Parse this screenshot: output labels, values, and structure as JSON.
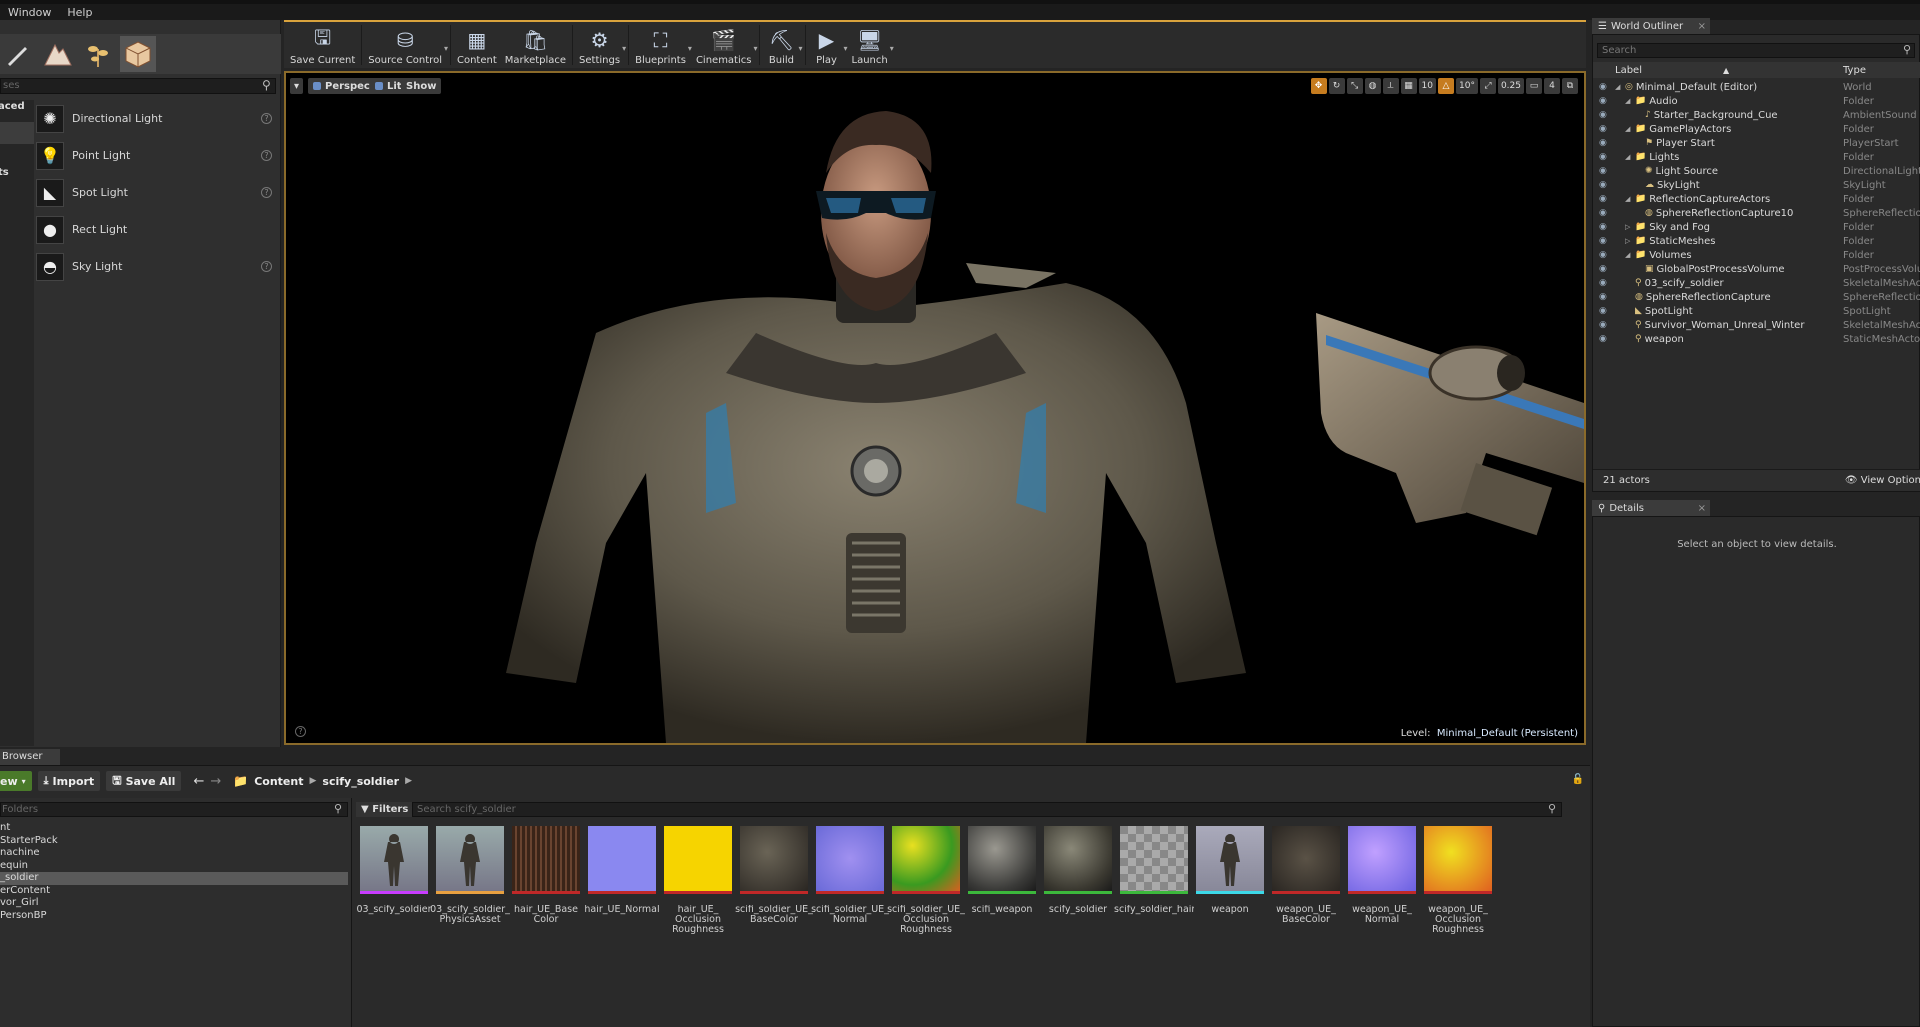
{
  "menu": {
    "items": [
      "Window",
      "Help"
    ],
    "close_glyph": "×"
  },
  "modes": {
    "icons": [
      "pencil-icon",
      "landscape-icon",
      "foliage-icon",
      "geometry-icon"
    ],
    "search_placeholder": "ses",
    "categories": [
      {
        "label": "aced",
        "selected": false
      },
      {
        "label": "",
        "selected": true
      },
      {
        "label": "",
        "selected": false
      },
      {
        "label": "ts",
        "selected": false
      },
      {
        "label": "",
        "selected": false
      }
    ],
    "items": [
      {
        "label": "Directional Light",
        "icon": "sun-icon",
        "help": true
      },
      {
        "label": "Point Light",
        "icon": "bulb-icon",
        "help": true
      },
      {
        "label": "Spot Light",
        "icon": "spotlight-icon",
        "help": true
      },
      {
        "label": "Rect Light",
        "icon": "sphere-icon",
        "help": false
      },
      {
        "label": "Sky Light",
        "icon": "dome-icon",
        "help": true
      }
    ]
  },
  "toolbar": {
    "buttons": [
      {
        "label": "Save Current",
        "icon": "floppy-icon",
        "dropdown": false
      },
      {
        "label": "Source Control",
        "icon": "source-control-icon",
        "dropdown": true
      },
      {
        "label": "Content",
        "icon": "content-grid-icon",
        "dropdown": false
      },
      {
        "label": "Marketplace",
        "icon": "marketplace-icon",
        "dropdown": false
      },
      {
        "label": "Settings",
        "icon": "gear-icon",
        "dropdown": true
      },
      {
        "label": "Blueprints",
        "icon": "blueprint-icon",
        "dropdown": true
      },
      {
        "label": "Cinematics",
        "icon": "clapper-icon",
        "dropdown": true
      },
      {
        "label": "Build",
        "icon": "build-icon",
        "dropdown": true
      },
      {
        "label": "Play",
        "icon": "play-icon",
        "dropdown": true
      },
      {
        "label": "Launch",
        "icon": "launch-icon",
        "dropdown": true
      }
    ]
  },
  "viewport": {
    "menu_glyph": "▾",
    "perspective_label": "Perspective",
    "lit_label": "Lit",
    "show_label": "Show",
    "grid_snap": "10",
    "rot_snap": "10°",
    "scale_snap": "0.25",
    "camera_speed": "4",
    "level_prefix": "Level:",
    "level_name": "Minimal_Default (Persistent)",
    "help_glyph": "?"
  },
  "outliner": {
    "tab_label": "World Outliner",
    "search_placeholder": "Search",
    "col_label": "Label",
    "col_type": "Type",
    "rows": [
      {
        "name": "Minimal_Default (Editor)",
        "type": "World",
        "indent": 0,
        "icon": "world-icon",
        "expanded": true
      },
      {
        "name": "Audio",
        "type": "Folder",
        "indent": 1,
        "icon": "folder-icon",
        "expanded": true
      },
      {
        "name": "Starter_Background_Cue",
        "type": "AmbientSound",
        "indent": 2,
        "icon": "sound-icon"
      },
      {
        "name": "GamePlayActors",
        "type": "Folder",
        "indent": 1,
        "icon": "folder-icon",
        "expanded": true
      },
      {
        "name": "Player Start",
        "type": "PlayerStart",
        "indent": 2,
        "icon": "player-icon"
      },
      {
        "name": "Lights",
        "type": "Folder",
        "indent": 1,
        "icon": "folder-icon",
        "expanded": true
      },
      {
        "name": "Light Source",
        "type": "DirectionalLight",
        "indent": 2,
        "icon": "sun-icon"
      },
      {
        "name": "SkyLight",
        "type": "SkyLight",
        "indent": 2,
        "icon": "sky-icon"
      },
      {
        "name": "ReflectionCaptureActors",
        "type": "Folder",
        "indent": 1,
        "icon": "folder-icon",
        "expanded": true
      },
      {
        "name": "SphereReflectionCapture10",
        "type": "SphereReflectionC",
        "indent": 2,
        "icon": "sphere-icon"
      },
      {
        "name": "Sky and Fog",
        "type": "Folder",
        "indent": 1,
        "icon": "folder-icon",
        "expanded": false
      },
      {
        "name": "StaticMeshes",
        "type": "Folder",
        "indent": 1,
        "icon": "folder-icon",
        "expanded": false
      },
      {
        "name": "Volumes",
        "type": "Folder",
        "indent": 1,
        "icon": "folder-icon",
        "expanded": true
      },
      {
        "name": "GlobalPostProcessVolume",
        "type": "PostProcessVolum",
        "indent": 2,
        "icon": "volume-icon"
      },
      {
        "name": "03_scify_soldier",
        "type": "SkeletalMeshActor",
        "indent": 1,
        "icon": "mesh-icon"
      },
      {
        "name": "SphereReflectionCapture",
        "type": "SphereReflectionC",
        "indent": 1,
        "icon": "sphere-icon"
      },
      {
        "name": "SpotLight",
        "type": "SpotLight",
        "indent": 1,
        "icon": "spotlight-icon"
      },
      {
        "name": "Survivor_Woman_Unreal_Winter",
        "type": "SkeletalMeshActor",
        "indent": 1,
        "icon": "mesh-icon"
      },
      {
        "name": "weapon",
        "type": "StaticMeshActor",
        "indent": 1,
        "icon": "mesh-icon"
      }
    ],
    "actor_count": "21 actors",
    "view_options": "View Option"
  },
  "details": {
    "tab_label": "Details",
    "empty_message": "Select an object to view details."
  },
  "content_browser": {
    "tab_label": "Browser",
    "add_new_label": "ew",
    "import_label": "Import",
    "save_all_label": "Save All",
    "breadcrumb": [
      "Content",
      "scify_soldier"
    ],
    "folder_search_placeholder": "Folders",
    "tree": [
      {
        "label": "nt",
        "selected": false
      },
      {
        "label": "StarterPack",
        "selected": false
      },
      {
        "label": "nachine",
        "selected": false
      },
      {
        "label": "equin",
        "selected": false
      },
      {
        "label": "_soldier",
        "selected": true
      },
      {
        "label": "erContent",
        "selected": false
      },
      {
        "label": "vor_Girl",
        "selected": false
      },
      {
        "label": "PersonBP",
        "selected": false
      }
    ],
    "filters_label": "Filters",
    "asset_search_placeholder": "Search scify_soldier",
    "assets": [
      {
        "name": "03_scify_soldier",
        "kind": "skeletal",
        "underline": "#c83cff"
      },
      {
        "name": "03_scify_soldier_ PhysicsAsset",
        "kind": "physics",
        "underline": "#e8a040"
      },
      {
        "name": "hair_UE_Base Color",
        "kind": "hair-tex",
        "underline": "#c02828"
      },
      {
        "name": "hair_UE_Normal",
        "kind": "normal",
        "underline": "#c02828"
      },
      {
        "name": "hair_UE_ Occlusion Roughness",
        "kind": "yellow",
        "underline": "#c02828"
      },
      {
        "name": "scifi_soldier_UE_ BaseColor",
        "kind": "armor-tex",
        "underline": "#c02828"
      },
      {
        "name": "scifi_soldier_UE_ Normal",
        "kind": "normal2",
        "underline": "#c02828"
      },
      {
        "name": "scifi_soldier_UE_ Occlusion Roughness",
        "kind": "orm",
        "underline": "#c02828"
      },
      {
        "name": "scifi_weapon",
        "kind": "material",
        "underline": "#3cb83c"
      },
      {
        "name": "scify_soldier",
        "kind": "material2",
        "underline": "#3cb83c"
      },
      {
        "name": "scify_soldier_hair",
        "kind": "hairmesh",
        "underline": "#3cb83c"
      },
      {
        "name": "weapon",
        "kind": "staticmesh",
        "underline": "#3cd8e8"
      },
      {
        "name": "weapon_UE_ BaseColor",
        "kind": "weapon-tex",
        "underline": "#c02828"
      },
      {
        "name": "weapon_UE_ Normal",
        "kind": "normal3",
        "underline": "#c02828"
      },
      {
        "name": "weapon_UE_ Occlusion Roughness",
        "kind": "orm2",
        "underline": "#c02828"
      }
    ]
  }
}
